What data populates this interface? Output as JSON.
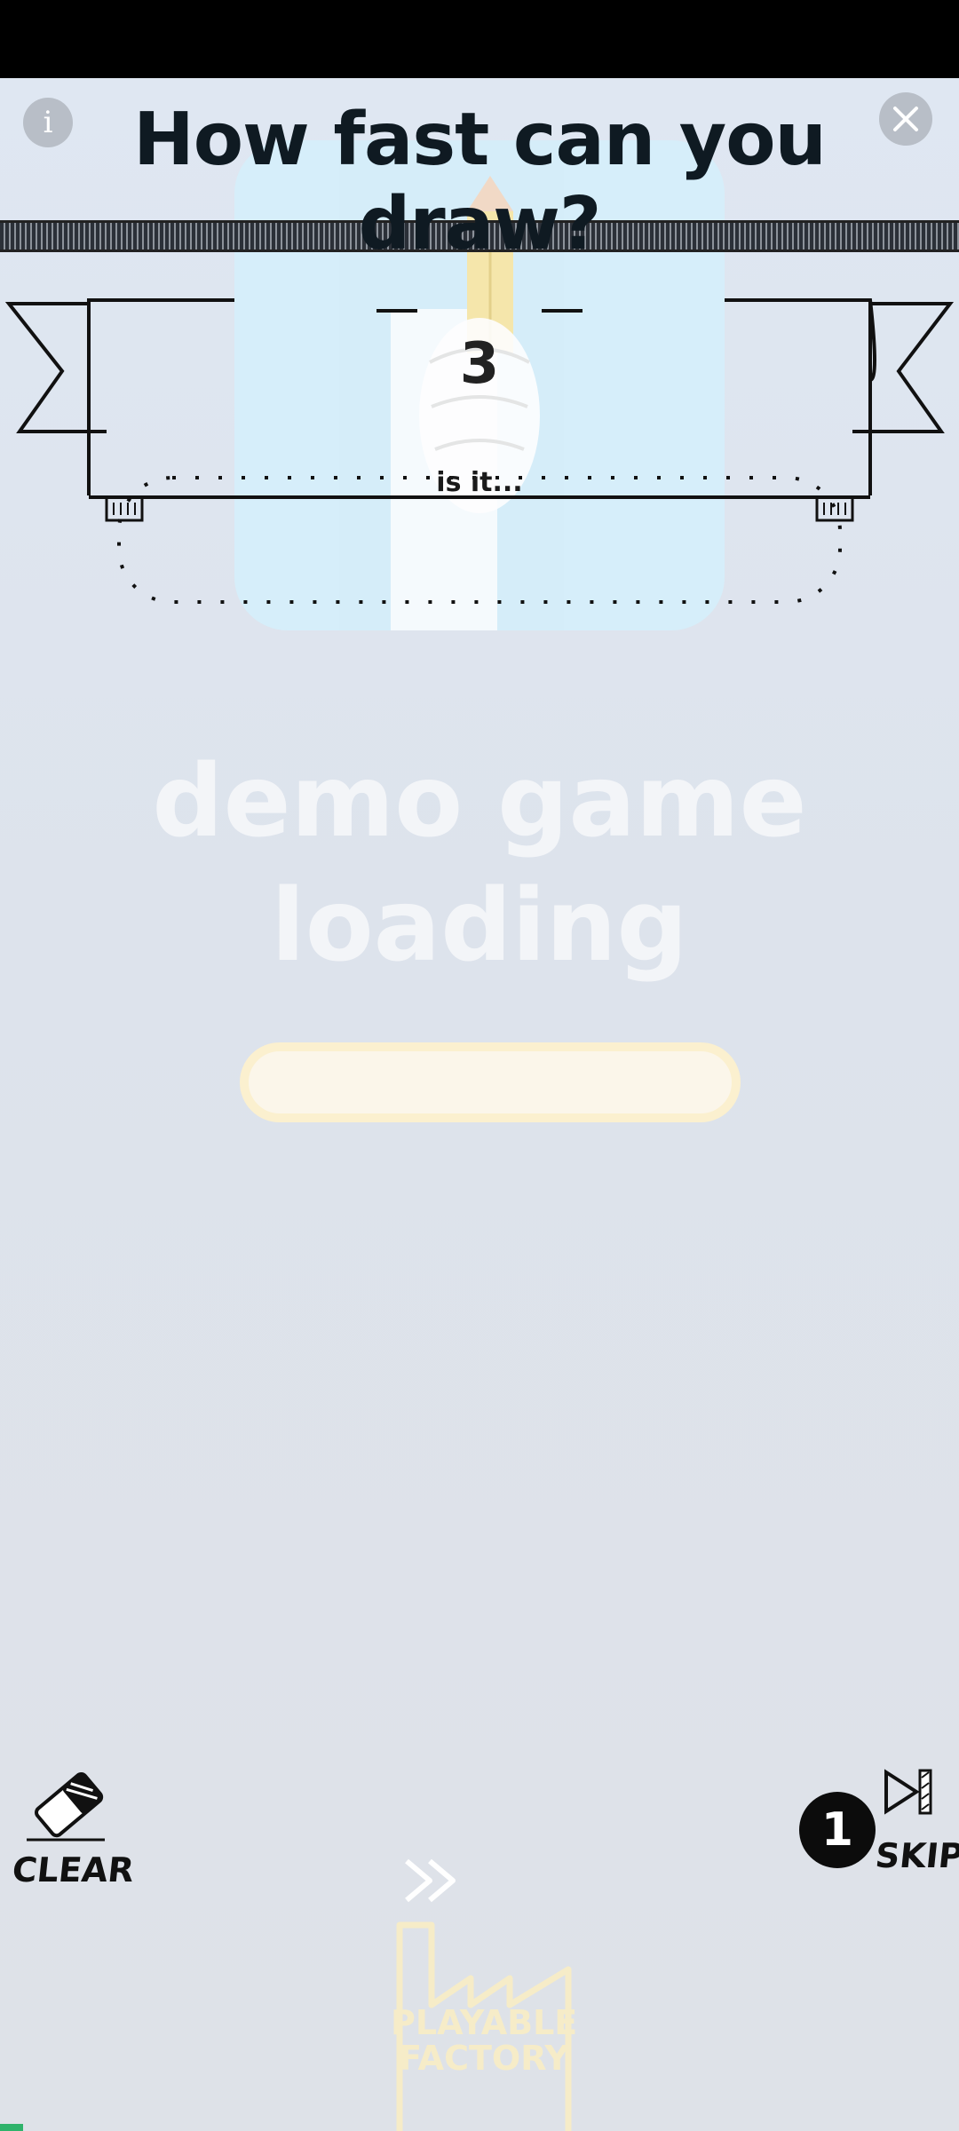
{
  "header": {
    "title": "How fast can you draw?",
    "info_label": "i"
  },
  "round": {
    "number": "3",
    "hint": "is it..."
  },
  "loading": {
    "line1": "demo game",
    "line2": "loading",
    "progress": 0.0
  },
  "controls": {
    "clear_label": "CLEAR",
    "skip_label": "SKIP",
    "skip_count": "1"
  },
  "branding": {
    "line1": "PLAYABLE",
    "line2": "FACTORY"
  },
  "colors": {
    "title": "#0f1a22",
    "tile": "#d5eefa",
    "progress_border": "#fbf0cf",
    "brand": "#f6ecc8"
  }
}
